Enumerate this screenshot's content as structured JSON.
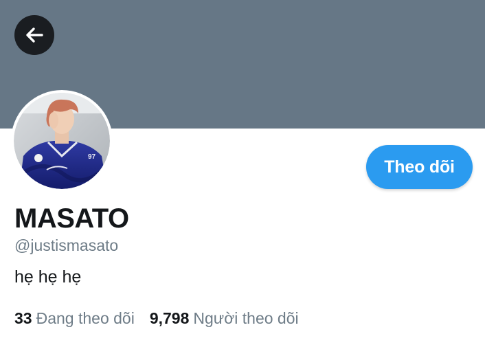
{
  "colors": {
    "banner": "#667786",
    "accent": "#2b9bf0",
    "text_primary": "#14171a",
    "text_secondary": "#6e7c87"
  },
  "header": {
    "back_icon": "arrow-left-icon"
  },
  "profile": {
    "display_name": "MASATO",
    "handle": "@justismasato",
    "bio": "hẹ hẹ hẹ",
    "follow_label": "Theo dõi",
    "following_count": "33",
    "following_label": "Đang theo dõi",
    "followers_count": "9,798",
    "followers_label": "Người theo dõi"
  }
}
